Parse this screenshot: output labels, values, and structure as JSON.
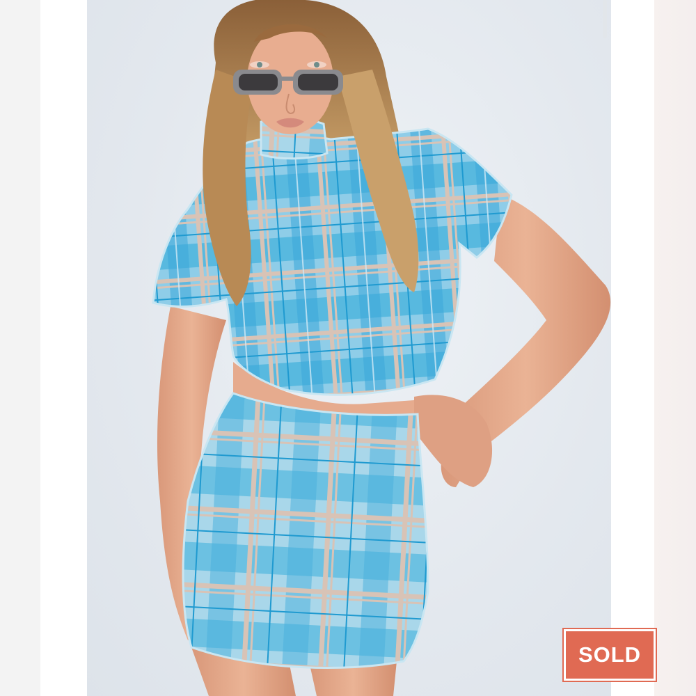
{
  "photo": {
    "subject": "model-in-blue-plaid-mesh-crop-top-and-mini-skirt",
    "colors": {
      "background": "#e4e9ef",
      "plaid_light": "#a9d7ea",
      "plaid_mid": "#4fb5dd",
      "plaid_dark": "#1f9ad0",
      "plaid_beige": "#d8c3b6",
      "skin": "#e2a58a",
      "hair": "#a6784a",
      "sunglasses": "#8a8a8e"
    }
  },
  "badge": {
    "label": "SOLD",
    "color": "#e06a53"
  }
}
